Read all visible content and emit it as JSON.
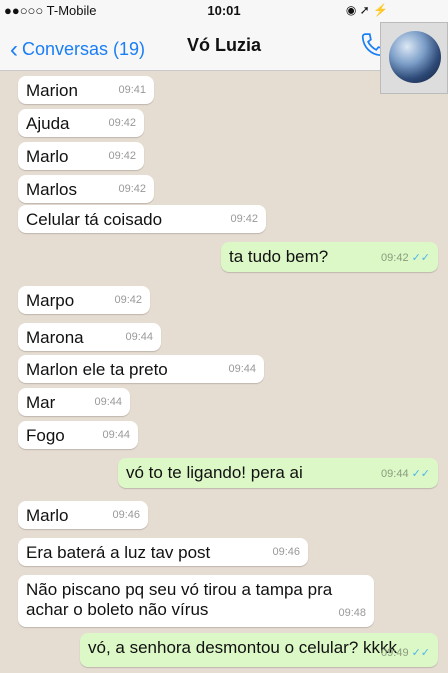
{
  "status_bar": {
    "carrier": "●●○○○ T-Mobile",
    "time": "10:01",
    "icons": "◉ ➚ ⚡"
  },
  "nav": {
    "back_label": "Conversas (19)",
    "title": "Vó Luzia"
  },
  "messages": [
    {
      "text": "Marion",
      "time": "09:41",
      "dir": "in"
    },
    {
      "text": "Ajuda",
      "time": "09:42",
      "dir": "in"
    },
    {
      "text": "Marlo",
      "time": "09:42",
      "dir": "in"
    },
    {
      "text": "Marlos",
      "time": "09:42",
      "dir": "in"
    },
    {
      "text": "Celular tá coisado",
      "time": "09:42",
      "dir": "in"
    },
    {
      "text": "ta tudo bem?",
      "time": "09:42",
      "dir": "out"
    },
    {
      "text": "Marpo",
      "time": "09:42",
      "dir": "in"
    },
    {
      "text": "Marona",
      "time": "09:44",
      "dir": "in"
    },
    {
      "text": "Marlon ele ta preto",
      "time": "09:44",
      "dir": "in"
    },
    {
      "text": "Mar",
      "time": "09:44",
      "dir": "in"
    },
    {
      "text": "Fogo",
      "time": "09:44",
      "dir": "in"
    },
    {
      "text": "vó to te ligando! pera ai",
      "time": "09:44",
      "dir": "out"
    },
    {
      "text": "Marlo",
      "time": "09:46",
      "dir": "in"
    },
    {
      "text": "Era baterá a luz tav post",
      "time": "09:46",
      "dir": "in"
    },
    {
      "text": "Não piscano pq seu vó tirou a tampa pra achar o boleto não vírus",
      "time": "09:48",
      "dir": "in"
    },
    {
      "text": "vó, a senhora desmontou o celular? kkkk",
      "time": "09:49",
      "dir": "out"
    }
  ],
  "ticks": "✓✓",
  "colors": {
    "accent": "#1a7ef5",
    "incoming": "#ffffff",
    "outgoing": "#dcf8c6",
    "background": "#e6ddd2",
    "read_ticks": "#4fb6ec"
  }
}
